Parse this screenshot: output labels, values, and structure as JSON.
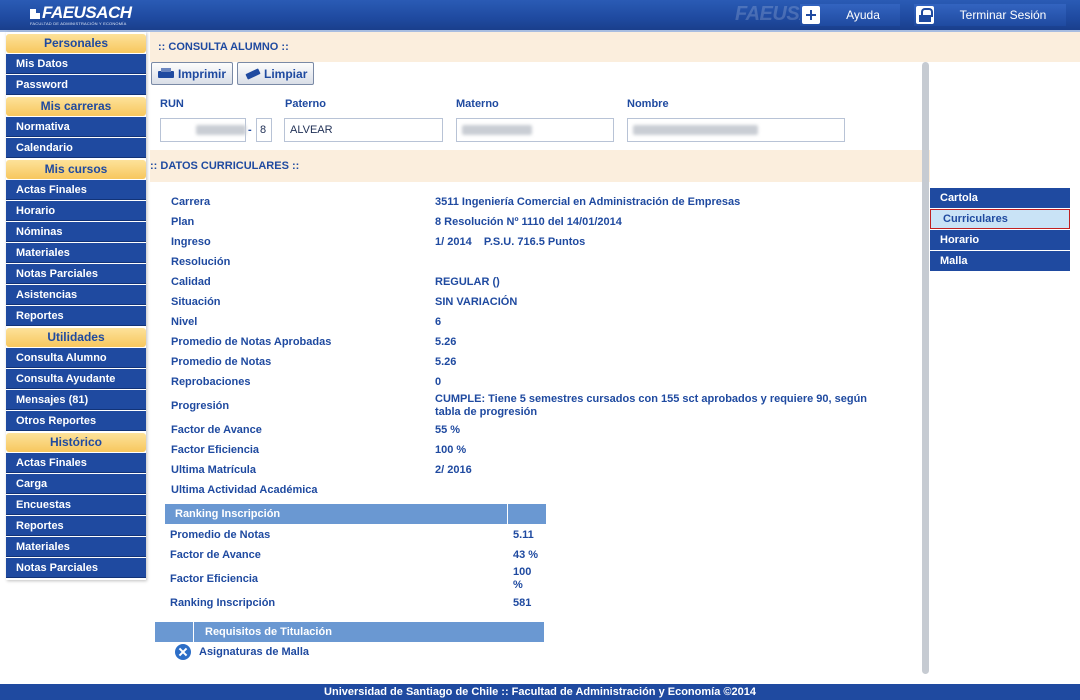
{
  "header": {
    "logo_text": "FAEUSACH",
    "logo_subtitle": "FACULTAD DE ADMINISTRACIÓN Y ECONOMÍA",
    "help_label": "Ayuda",
    "logout_label": "Terminar Sesión"
  },
  "sidebar": {
    "sections": [
      {
        "title": "Personales",
        "items": [
          "Mis Datos",
          "Password"
        ]
      },
      {
        "title": "Mis carreras",
        "items": [
          "Normativa",
          "Calendario"
        ]
      },
      {
        "title": "Mis cursos",
        "items": [
          "Actas Finales",
          "Horario",
          "Nóminas",
          "Materiales",
          "Notas Parciales",
          "Asistencias",
          "Reportes"
        ]
      },
      {
        "title": "Utilidades",
        "items": [
          "Consulta Alumno",
          "Consulta Ayudante",
          "Mensajes (81)",
          "Otros Reportes"
        ]
      },
      {
        "title": "Histórico",
        "items": [
          "Actas Finales",
          "Carga",
          "Encuestas",
          "Reportes",
          "Materiales",
          "Notas Parciales"
        ]
      }
    ]
  },
  "page": {
    "title": ":: CONSULTA ALUMNO ::",
    "print_label": "Imprimir",
    "clear_label": "Limpiar"
  },
  "search": {
    "run_label": "RUN",
    "paterno_label": "Paterno",
    "materno_label": "Materno",
    "nombre_label": "Nombre",
    "run_dv": "8",
    "run_dash": "-",
    "paterno_value": "ALVEAR"
  },
  "curricular": {
    "title": ":: DATOS CURRICULARES ::",
    "rows": [
      {
        "label": "Carrera",
        "value": "3511 Ingeniería Comercial en Administración de Empresas"
      },
      {
        "label": "Plan",
        "value": "8  Resolución Nº 1110 del 14/01/2014"
      },
      {
        "label": "Ingreso",
        "value": "1/ 2014    P.S.U. 716.5 Puntos"
      },
      {
        "label": "Resolución",
        "value": ""
      },
      {
        "label": "Calidad",
        "value": "REGULAR ()"
      },
      {
        "label": "Situación",
        "value": "SIN VARIACIÓN"
      },
      {
        "label": "Nivel",
        "value": "6"
      },
      {
        "label": "Promedio de Notas Aprobadas",
        "value": "5.26"
      },
      {
        "label": "Promedio de Notas",
        "value": "5.26"
      },
      {
        "label": "Reprobaciones",
        "value": "0"
      },
      {
        "label": "Progresión",
        "value": "CUMPLE: Tiene 5 semestres cursados con 155 sct aprobados y requiere 90, según tabla de progresión"
      },
      {
        "label": "Factor de Avance",
        "value": "55 %"
      },
      {
        "label": "Factor Eficiencia",
        "value": "100 %"
      },
      {
        "label": "Ultima Matrícula",
        "value": "2/ 2016"
      },
      {
        "label": "Ultima Actividad Académica",
        "value": ""
      }
    ]
  },
  "ranking": {
    "title": "Ranking Inscripción",
    "rows": [
      {
        "label": "Promedio de Notas",
        "value": "5.11"
      },
      {
        "label": "Factor de Avance",
        "value": "43 %"
      },
      {
        "label": "Factor Eficiencia",
        "value": "100 %"
      },
      {
        "label": "Ranking Inscripción",
        "value": "581"
      }
    ]
  },
  "requisitos": {
    "title": "Requisitos de Titulación",
    "item": "Asignaturas de Malla"
  },
  "right_nav": [
    "Cartola",
    "Curriculares",
    "Horario",
    "Malla"
  ],
  "footer": "Universidad de Santiago de Chile :: Facultad de Administración y Economía ©2014"
}
